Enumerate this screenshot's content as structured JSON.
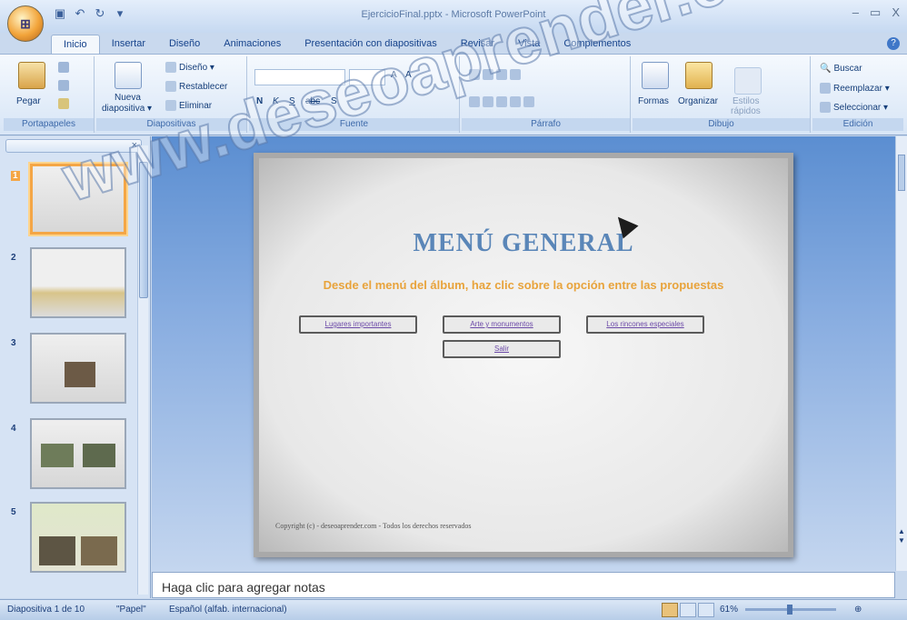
{
  "window": {
    "title": "EjercicioFinal.pptx - Microsoft PowerPoint",
    "controls": [
      "–",
      "▭",
      "X"
    ]
  },
  "office_button": {
    "label": "⊞"
  },
  "qat": {
    "save": "▣",
    "undo": "↶",
    "redo": "↻",
    "more": "▾"
  },
  "tabs": [
    "Inicio",
    "Insertar",
    "Diseño",
    "Animaciones",
    "Presentación con diapositivas",
    "Revisar",
    "Vista",
    "Complementos"
  ],
  "ribbon": {
    "portapapeles": {
      "label": "Portapapeles",
      "pegar": "Pegar"
    },
    "diapositivas": {
      "label": "Diapositivas",
      "nueva": "Nueva",
      "nueva2": "diapositiva ▾",
      "diseno": "Diseño ▾",
      "restablecer": "Restablecer",
      "eliminar": "Eliminar"
    },
    "fuente": {
      "label": "Fuente",
      "bold": "N",
      "italic": "K",
      "underline": "S",
      "strike": "abc",
      "shadow": "S",
      "grow": "A",
      "shrink": "A"
    },
    "parrafo": {
      "label": "Párrafo"
    },
    "dibujo": {
      "label": "Dibujo",
      "formas": "Formas",
      "organizar": "Organizar",
      "estilos": "Estilos",
      "estilos2": "rápidos"
    },
    "edicion": {
      "label": "Edición",
      "buscar": "Buscar",
      "reemplazar": "Reemplazar ▾",
      "seleccionar": "Seleccionar ▾"
    }
  },
  "thumbnails": [
    {
      "num": "1"
    },
    {
      "num": "2"
    },
    {
      "num": "3"
    },
    {
      "num": "4"
    },
    {
      "num": "5"
    }
  ],
  "slide": {
    "title": "MENÚ GENERAL",
    "subtitle": "Desde el menú del álbum, haz clic sobre la opción entre las propuestas",
    "links": [
      "Lugares importantes",
      "Arte y monumentos",
      "Los rincones especiales",
      "Salir"
    ],
    "footer": "Copyright (c) - deseoaprender.com - Todos los derechos reservados"
  },
  "watermark": "www.deseoaprender.com",
  "notes": {
    "placeholder": "Haga clic para agregar notas"
  },
  "status": {
    "slide": "Diapositiva 1 de 10",
    "theme": "\"Papel\"",
    "language": "Español (alfab. internacional)",
    "zoom": "61%"
  },
  "colors": {
    "accent": "#f4a646",
    "slide_title": "#5a86b8",
    "subtitle": "#e8a33b"
  }
}
